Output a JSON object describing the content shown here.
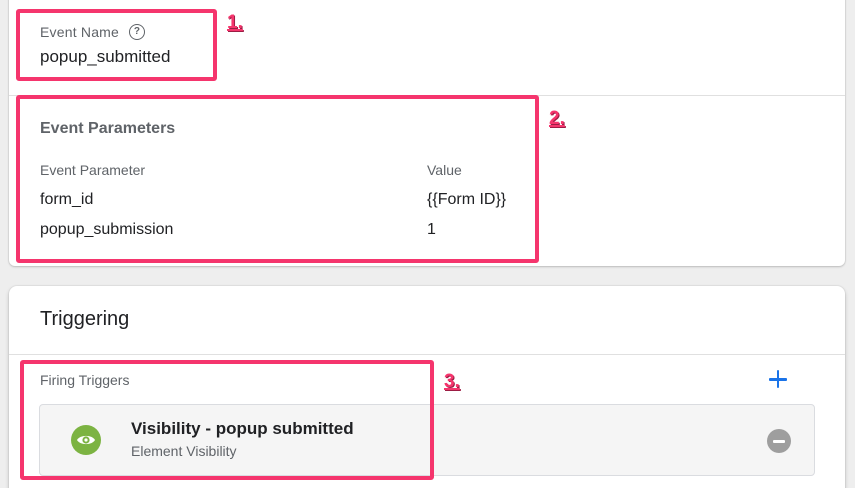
{
  "event": {
    "name_label": "Event Name",
    "name_value": "popup_submitted",
    "help_icon": "help-circle-icon"
  },
  "parameters": {
    "title": "Event Parameters",
    "col_param": "Event Parameter",
    "col_value": "Value",
    "rows": [
      {
        "param": "form_id",
        "value": "{{Form ID}}"
      },
      {
        "param": "popup_submission",
        "value": "1"
      }
    ]
  },
  "triggering": {
    "title": "Triggering",
    "firing_label": "Firing Triggers",
    "add_icon": "plus-icon",
    "trigger": {
      "name": "Visibility - popup submitted",
      "type": "Element Visibility",
      "icon": "eye-icon",
      "remove_icon": "minus-circle-icon"
    }
  },
  "annotations": {
    "label_1": "1.",
    "label_2": "2.",
    "label_3": "3.",
    "color": "#f5356d"
  }
}
